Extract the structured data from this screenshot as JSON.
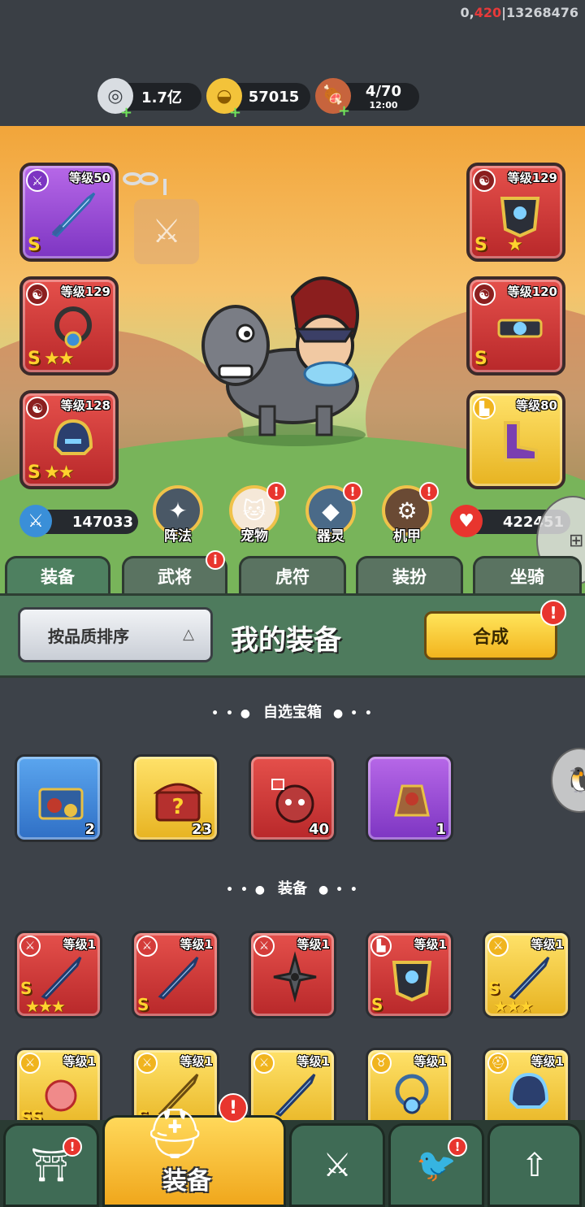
{
  "debug": {
    "prefix": "0,",
    "highlight": "420",
    "suffix": "|13268476"
  },
  "resources": {
    "silver": {
      "value": "1.7亿",
      "icon": "silver-coin-icon"
    },
    "gold": {
      "value": "57015",
      "icon": "gold-ingot-icon"
    },
    "stamina": {
      "value": "4/70",
      "timer": "12:00",
      "icon": "meat-leg-icon"
    }
  },
  "equipped": {
    "weapon": {
      "level": "等级50",
      "grade": "S",
      "stars": ""
    },
    "slot_right_1": {
      "level": "等级129",
      "grade": "S",
      "stars": "★"
    },
    "slot_left_2": {
      "level": "等级129",
      "grade": "S",
      "stars": "★★"
    },
    "slot_right_2": {
      "level": "等级120",
      "grade": "S",
      "stars": ""
    },
    "slot_left_3": {
      "level": "等级128",
      "grade": "S",
      "stars": "★★"
    },
    "slot_right_3": {
      "level": "等级80",
      "grade": "",
      "stars": ""
    }
  },
  "stats": {
    "attack": "147033",
    "hp": "422451"
  },
  "features": [
    {
      "label": "阵法",
      "badge": false
    },
    {
      "label": "宠物",
      "badge": true
    },
    {
      "label": "器灵",
      "badge": true
    },
    {
      "label": "机甲",
      "badge": true
    }
  ],
  "tabs": [
    {
      "label": "装备",
      "active": true
    },
    {
      "label": "武将",
      "badge": "i"
    },
    {
      "label": "虎符"
    },
    {
      "label": "装扮"
    },
    {
      "label": "坐骑"
    }
  ],
  "header": {
    "sort_label": "按品质排序",
    "sort_arrow": "△",
    "title": "我的装备",
    "synth_label": "合成",
    "badge": "!"
  },
  "sections": {
    "chests_title": "自选宝箱",
    "equip_title": "装备"
  },
  "chests": [
    {
      "rarity": "blue",
      "count": "2"
    },
    {
      "rarity": "gold",
      "count": "23"
    },
    {
      "rarity": "red",
      "count": "40"
    },
    {
      "rarity": "purple",
      "count": "1"
    }
  ],
  "equip_row1": [
    {
      "rarity": "red",
      "level": "等级1",
      "grade": "S",
      "stars": "★★★"
    },
    {
      "rarity": "red",
      "level": "等级1",
      "grade": "S",
      "stars": ""
    },
    {
      "rarity": "red",
      "level": "等级1",
      "grade": "",
      "stars": ""
    },
    {
      "rarity": "red",
      "level": "等级1",
      "grade": "S",
      "stars": ""
    },
    {
      "rarity": "gold",
      "level": "等级1",
      "grade": "S",
      "stars": "★★★"
    }
  ],
  "equip_row2": [
    {
      "rarity": "gold",
      "level": "等级1",
      "grade": "SS"
    },
    {
      "rarity": "gold",
      "level": "等级1",
      "grade": "S"
    },
    {
      "rarity": "gold",
      "level": "等级1",
      "grade": ""
    },
    {
      "rarity": "gold",
      "level": "等级1",
      "grade": ""
    },
    {
      "rarity": "gold",
      "level": "等级1",
      "grade": ""
    }
  ],
  "bottom_nav": {
    "active_label": "装备",
    "badge": "!"
  },
  "colors": {
    "accent_gold": "#f0b41e",
    "panel_green": "#4e7b5d",
    "badge_red": "#e8352e"
  }
}
